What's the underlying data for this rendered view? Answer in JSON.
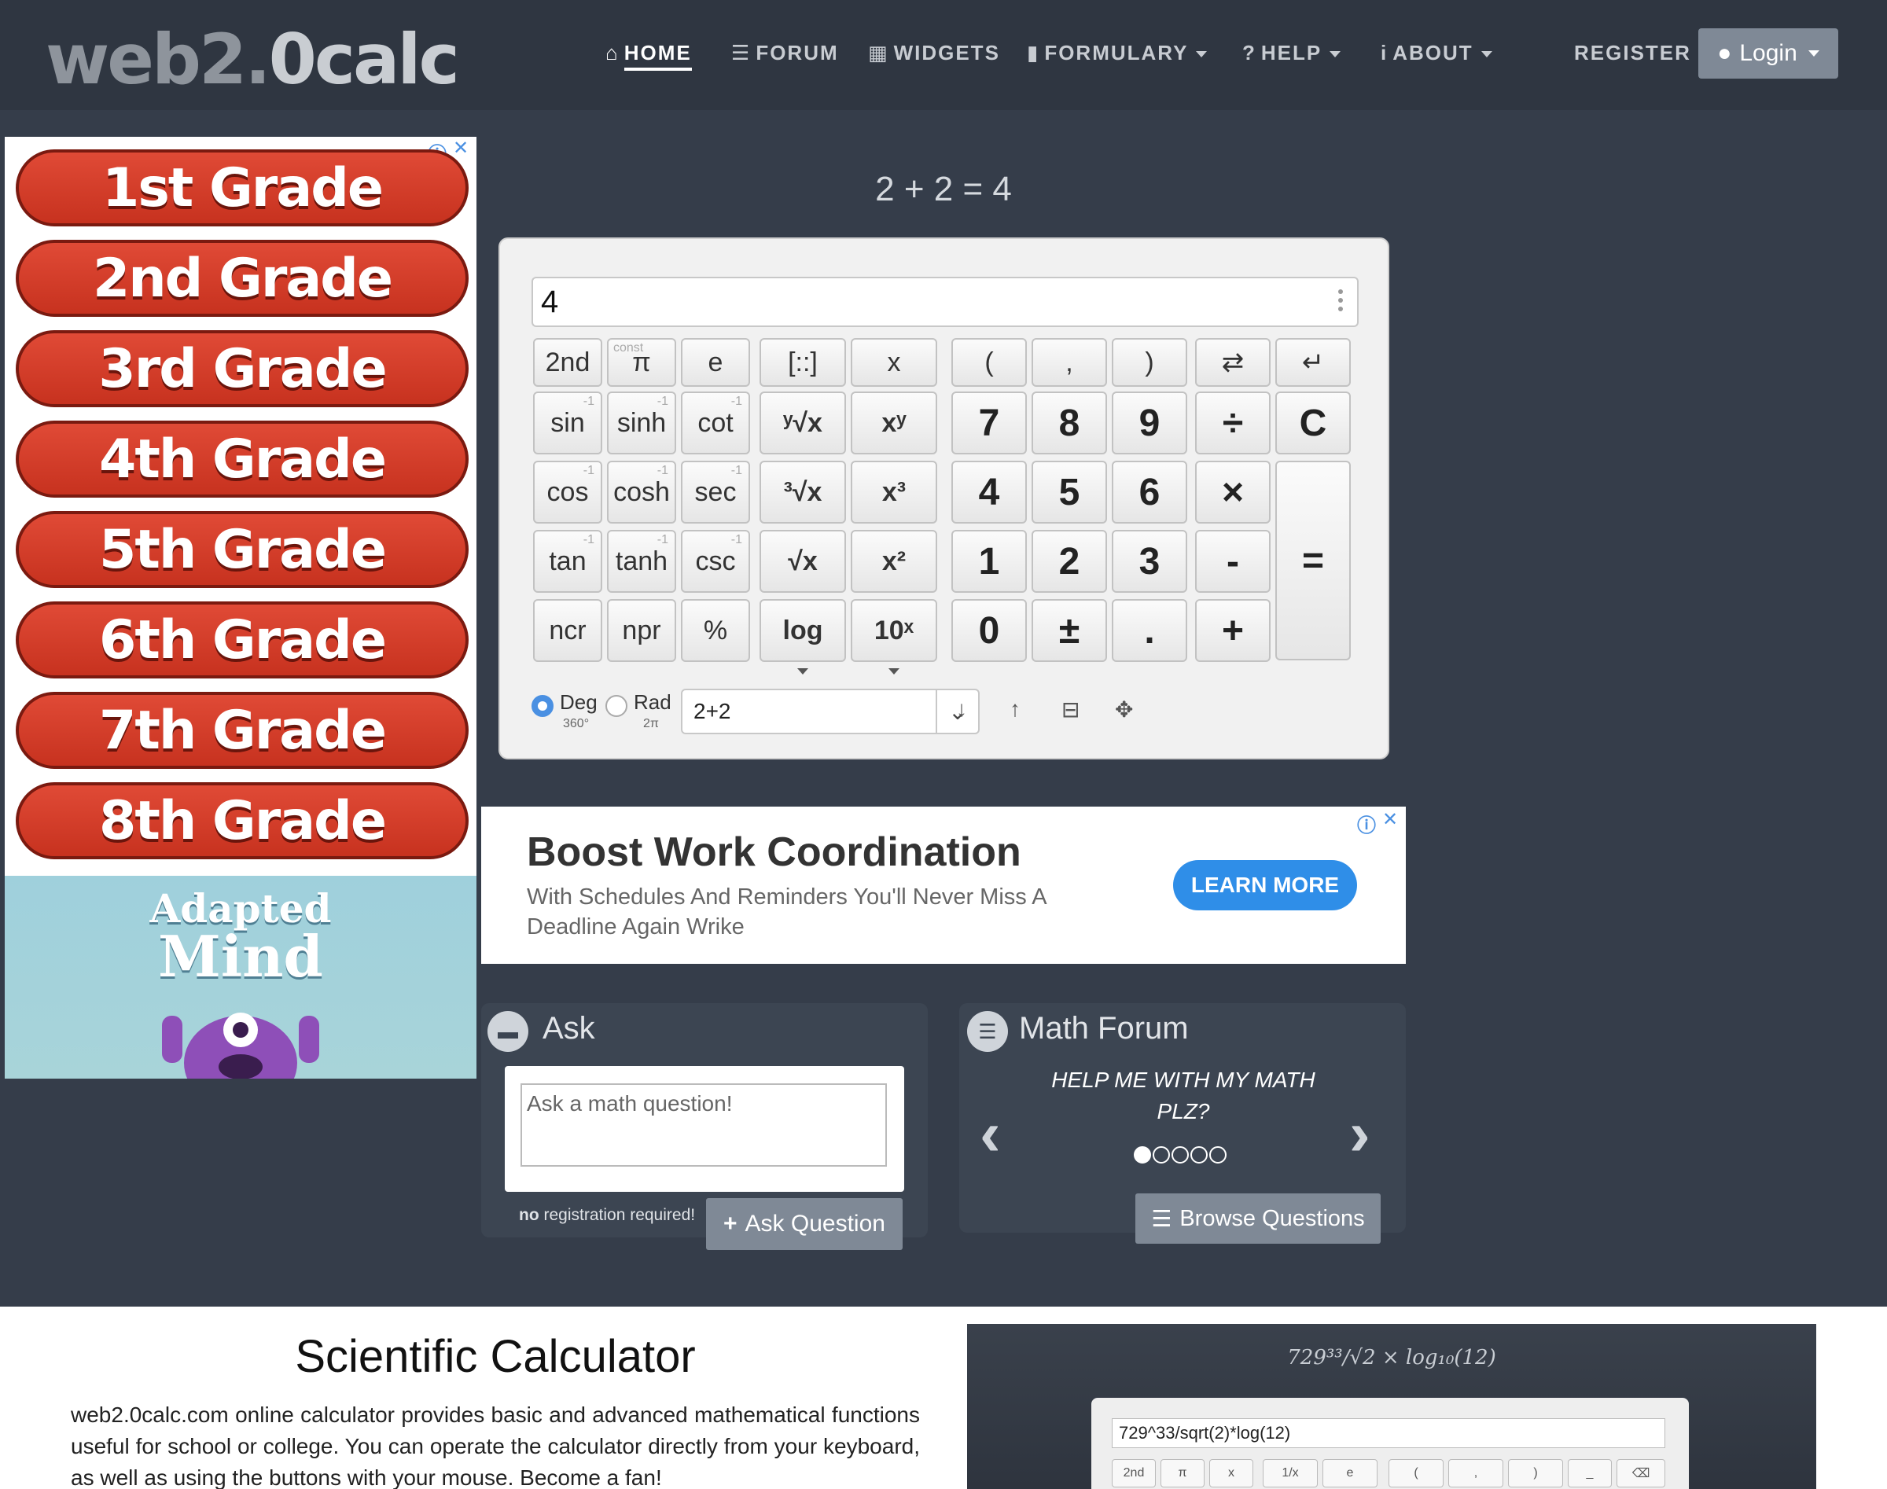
{
  "nav": {
    "logo_light": "web2.",
    "logo_bold": "0calc",
    "items": [
      {
        "label": "HOME",
        "icon": "home-icon",
        "glyph": "⌂"
      },
      {
        "label": "FORUM",
        "icon": "list-icon",
        "glyph": "☰"
      },
      {
        "label": "WIDGETS",
        "icon": "calendar-icon",
        "glyph": "▦"
      },
      {
        "label": "FORMULARY",
        "icon": "book-icon",
        "glyph": "▮"
      },
      {
        "label": "HELP",
        "icon": "question-icon",
        "glyph": "?"
      },
      {
        "label": "ABOUT",
        "icon": "info-icon",
        "glyph": "i"
      }
    ],
    "register": "REGISTER",
    "login": "Login"
  },
  "left_ad": {
    "grades": [
      "1st Grade",
      "2nd Grade",
      "3rd Grade",
      "4th Grade",
      "5th Grade",
      "6th Grade",
      "7th Grade",
      "8th Grade"
    ],
    "brand_top": "Adapted",
    "brand_bottom": "Mind"
  },
  "calc": {
    "header_formula": "2 + 2 = 4",
    "display_value": "4",
    "keys": {
      "second": "2nd",
      "const": "const",
      "pi": "π",
      "e": "e",
      "matrix": "[::]",
      "x": "x",
      "lparen": "(",
      "comma": ",",
      "rparen": ")",
      "swap": "⇄",
      "back": "↵",
      "sin": "sin",
      "sinh": "sinh",
      "cot": "cot",
      "yroot": "ʸ√x",
      "xpow": "xʸ",
      "n7": "7",
      "n8": "8",
      "n9": "9",
      "div": "÷",
      "clear": "C",
      "cos": "cos",
      "cosh": "cosh",
      "sec": "sec",
      "croot": "³√x",
      "xcube": "x³",
      "n4": "4",
      "n5": "5",
      "n6": "6",
      "mul": "×",
      "equals": "=",
      "tan": "tan",
      "tanh": "tanh",
      "csc": "csc",
      "sqrt": "√x",
      "xsq": "x²",
      "n1": "1",
      "n2": "2",
      "n3": "3",
      "minus": "-",
      "ncr": "ncr",
      "npr": "npr",
      "pct": "%",
      "log": "log",
      "tenx": "10ˣ",
      "n0": "0",
      "pm": "±",
      "dot": ".",
      "plus": "+"
    },
    "inverse_mark": "-1",
    "deg": "Deg",
    "deg_sub": "360°",
    "rad": "Rad",
    "rad_sub": "2π",
    "history_value": "2+2"
  },
  "banner": {
    "title": "Boost Work Coordination",
    "text": "With Schedules And Reminders You'll Never Miss A Deadline Again Wrike",
    "cta": "LEARN MORE"
  },
  "ask": {
    "title": "Ask",
    "placeholder": "Ask a math question!",
    "note_bold": "no",
    "note_rest": " registration required!",
    "button": "Ask Question"
  },
  "forum": {
    "title": "Math Forum",
    "question": "HELP ME WITH MY MATH PLZ?",
    "button": "Browse Questions"
  },
  "about": {
    "title": "Scientific Calculator",
    "text": "web2.0calc.com online calculator provides basic and advanced mathematical functions useful for school or college. You can operate the calculator directly from your keyboard, as well as using the buttons with your mouse. Become a fan!"
  },
  "promo": {
    "formula": "729³³/√2 × log₁₀(12)",
    "input": "729^33/sqrt(2)*log(12)",
    "keys": [
      "2nd",
      "π",
      "x",
      "1/x",
      "e",
      "(",
      ",",
      ")",
      "_",
      "⌫"
    ]
  }
}
